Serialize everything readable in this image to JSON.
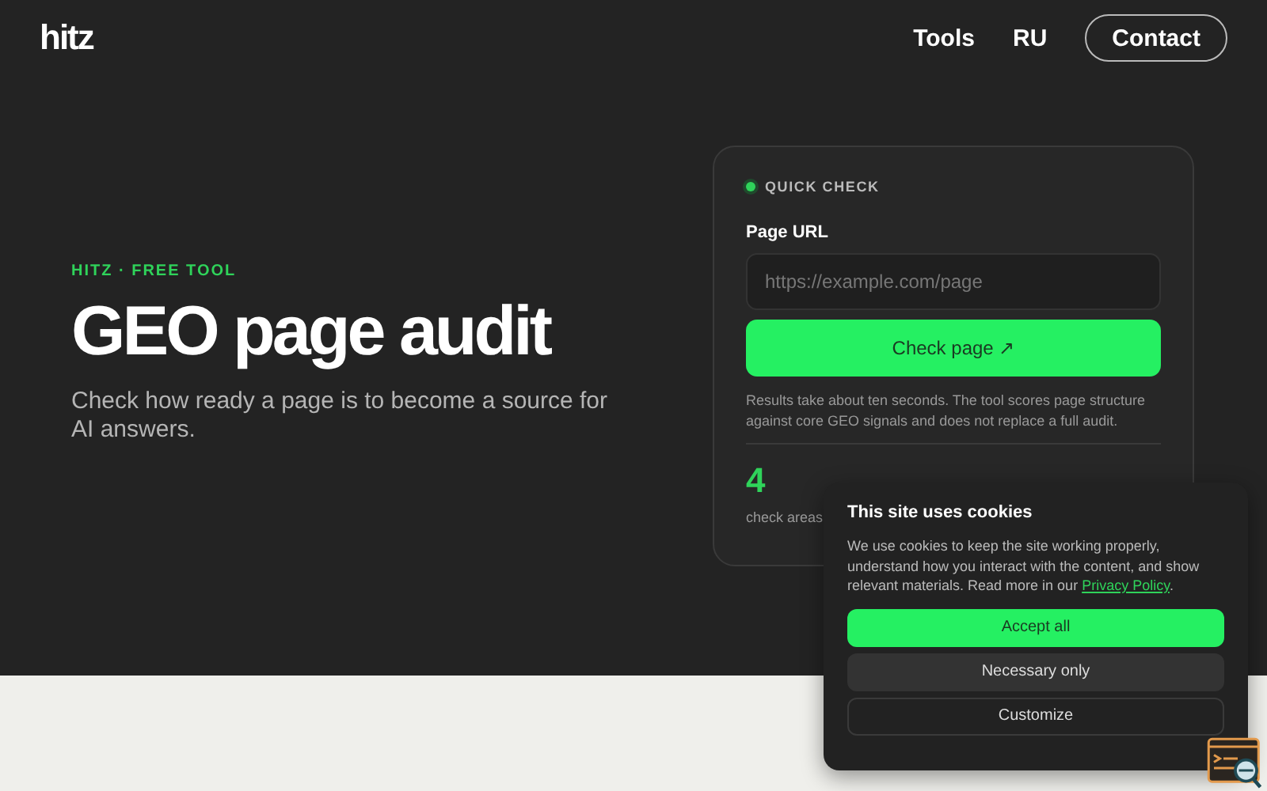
{
  "header": {
    "logo": "hitz",
    "nav": [
      {
        "label": "Tools"
      },
      {
        "label": "RU"
      }
    ],
    "contact": "Contact"
  },
  "hero": {
    "eyebrow": "HITZ · FREE TOOL",
    "title": "GEO page audit",
    "subtitle": "Check how ready a page is to become a source for AI answers."
  },
  "card": {
    "badge": "QUICK CHECK",
    "field_label": "Page URL",
    "placeholder": "https://example.com/page",
    "button": "Check page ↗",
    "note": "Results take about ten seconds. The tool scores page structure against core GEO signals and does not replace a full audit.",
    "stat_value": "4",
    "stat_label": "check areas"
  },
  "cookie_banner": {
    "title": "This site uses cookies",
    "text": "We use cookies to keep the site working properly, understand how you interact with the content, and show relevant materials. Read more in our",
    "link": "Privacy Policy",
    "after_link": ".",
    "buttons": [
      {
        "label": "Accept all",
        "kind": "primary"
      },
      {
        "label": "Necessary only",
        "kind": "secondary"
      },
      {
        "label": "Customize",
        "kind": "outline"
      }
    ]
  }
}
